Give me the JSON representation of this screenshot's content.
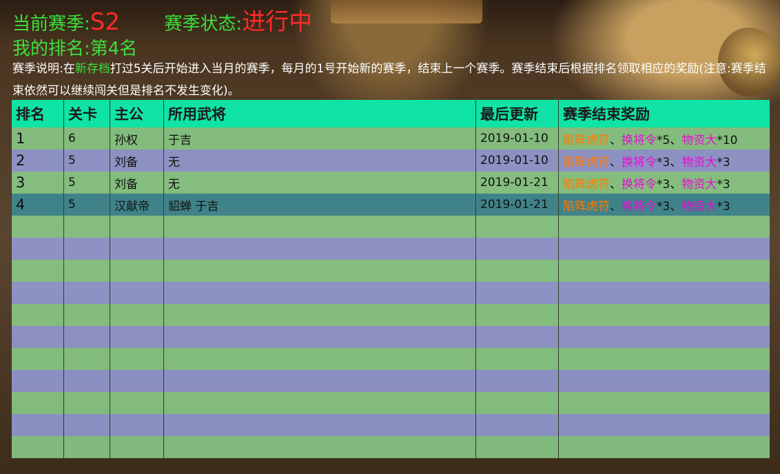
{
  "season": {
    "current_label": "当前赛季:",
    "current_value": "S2",
    "status_label": "赛季状态:",
    "status_value": "进行中",
    "my_rank_label": "我的排名:",
    "my_rank_value": "第4名"
  },
  "description": {
    "prefix": "赛季说明:在",
    "highlight": "新存档",
    "rest": "打过5关后开始进入当月的赛季，每月的1号开始新的赛季，结束上一个赛季。赛季结束后根据排名领取相应的奖励(注意:赛季结束依然可以继续闯关但是排名不发生变化)。"
  },
  "colors": {
    "header_green": "#3ce03c",
    "value_red": "#ff2a2a",
    "table_header": "#0fe3a6",
    "reward_item_a": "#ff7a00",
    "reward_item_b": "#e010d0"
  },
  "table": {
    "headers": [
      "排名",
      "关卡",
      "主公",
      "所用武将",
      "最后更新",
      "赛季结束奖励"
    ],
    "rows": [
      {
        "rank": "1",
        "level": "6",
        "lord": "孙权",
        "generals": "于吉",
        "updated": "2019-01-10",
        "reward": {
          "a": "陷阵虎符",
          "sep1": "、",
          "b": "换将令",
          "b_qty": "*5",
          "sep2": "、",
          "c": "物资大",
          "c_qty": "*10"
        }
      },
      {
        "rank": "2",
        "level": "5",
        "lord": "刘备",
        "generals": "无",
        "updated": "2019-01-10",
        "reward": {
          "a": "陷阵虎符",
          "sep1": "、",
          "b": "换将令",
          "b_qty": "*3",
          "sep2": "、",
          "c": "物资大",
          "c_qty": "*3"
        }
      },
      {
        "rank": "3",
        "level": "5",
        "lord": "刘备",
        "generals": "无",
        "updated": "2019-01-21",
        "reward": {
          "a": "陷阵虎符",
          "sep1": "、",
          "b": "换将令",
          "b_qty": "*3",
          "sep2": "、",
          "c": "物资大",
          "c_qty": "*3"
        }
      },
      {
        "rank": "4",
        "level": "5",
        "lord": "汉献帝",
        "generals": "貂蝉 于吉",
        "updated": "2019-01-21",
        "reward": {
          "a": "陷阵虎符",
          "sep1": "、",
          "b": "换将令",
          "b_qty": "*3",
          "sep2": "、",
          "c": "物资大",
          "c_qty": "*3"
        }
      }
    ],
    "selected_row_index": 3
  }
}
